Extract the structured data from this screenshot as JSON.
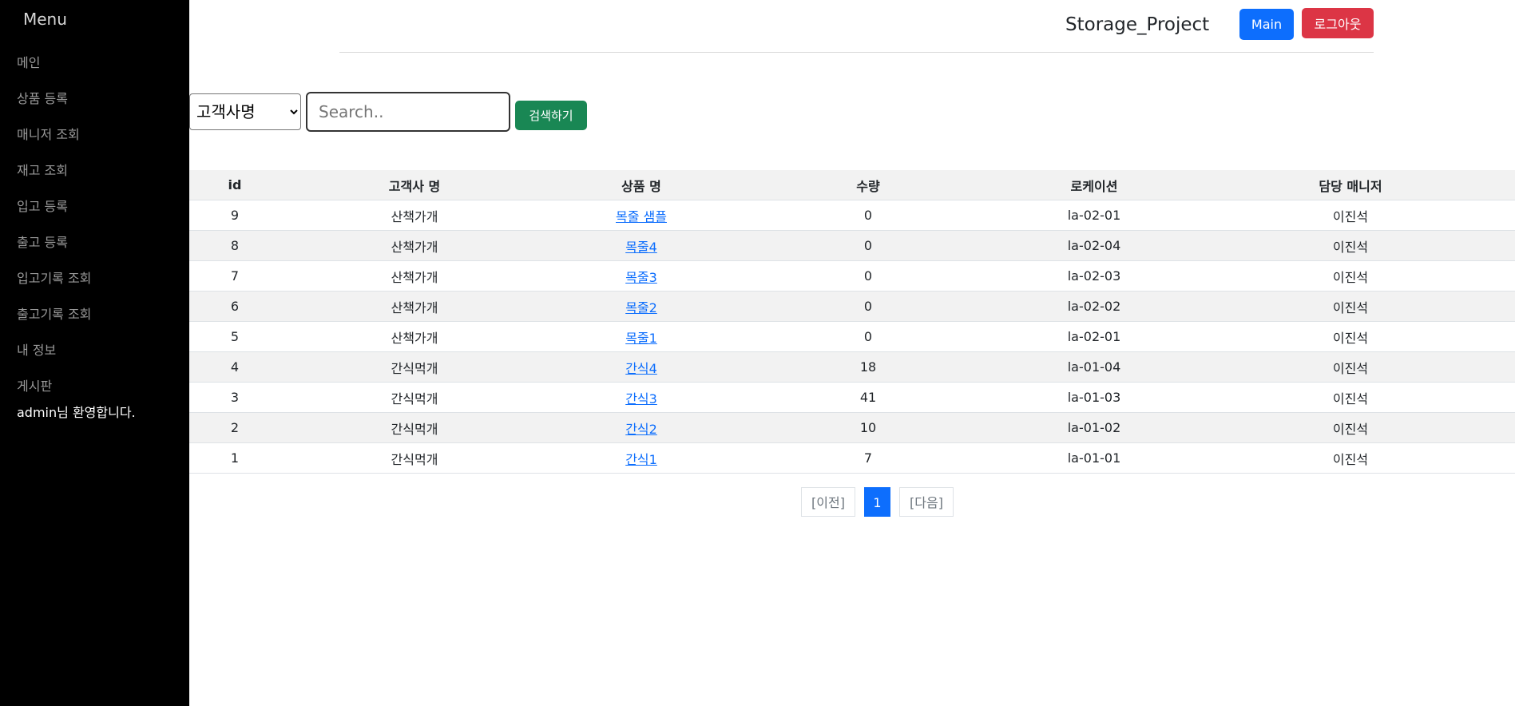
{
  "sidebar": {
    "title": "Menu",
    "items": [
      {
        "label": "메인"
      },
      {
        "label": "상품 등록"
      },
      {
        "label": "매니저 조회"
      },
      {
        "label": "재고 조회"
      },
      {
        "label": "입고 등록"
      },
      {
        "label": "출고 등록"
      },
      {
        "label": "입고기록 조회"
      },
      {
        "label": "출고기록 조회"
      },
      {
        "label": "내 정보"
      },
      {
        "label": "게시판"
      }
    ],
    "welcome": "admin님 환영합니다."
  },
  "header": {
    "title": "Storage_Project",
    "main_label": "Main",
    "logout_label": "로그아웃"
  },
  "search": {
    "select_options": [
      "고객사명"
    ],
    "selected": "고객사명",
    "placeholder": "Search..",
    "value": "",
    "button_label": "검색하기"
  },
  "table": {
    "headers": [
      "id",
      "고객사 명",
      "상품 명",
      "수량",
      "로케이션",
      "담당 매니저"
    ],
    "rows": [
      {
        "id": "9",
        "customer": "산책가개",
        "product": "목줄 샘플",
        "qty": "0",
        "location": "la-02-01",
        "manager": "이진석"
      },
      {
        "id": "8",
        "customer": "산책가개",
        "product": "목줄4",
        "qty": "0",
        "location": "la-02-04",
        "manager": "이진석"
      },
      {
        "id": "7",
        "customer": "산책가개",
        "product": "목줄3",
        "qty": "0",
        "location": "la-02-03",
        "manager": "이진석"
      },
      {
        "id": "6",
        "customer": "산책가개",
        "product": "목줄2",
        "qty": "0",
        "location": "la-02-02",
        "manager": "이진석"
      },
      {
        "id": "5",
        "customer": "산책가개",
        "product": "목줄1",
        "qty": "0",
        "location": "la-02-01",
        "manager": "이진석"
      },
      {
        "id": "4",
        "customer": "간식먹개",
        "product": "간식4",
        "qty": "18",
        "location": "la-01-04",
        "manager": "이진석"
      },
      {
        "id": "3",
        "customer": "간식먹개",
        "product": "간식3",
        "qty": "41",
        "location": "la-01-03",
        "manager": "이진석"
      },
      {
        "id": "2",
        "customer": "간식먹개",
        "product": "간식2",
        "qty": "10",
        "location": "la-01-02",
        "manager": "이진석"
      },
      {
        "id": "1",
        "customer": "간식먹개",
        "product": "간식1",
        "qty": "7",
        "location": "la-01-01",
        "manager": "이진석"
      }
    ]
  },
  "pagination": {
    "prev_label": "[이전]",
    "current_page": "1",
    "next_label": "[다음]"
  },
  "colors": {
    "sidebar_bg": "#000000",
    "primary": "#0d6efd",
    "danger": "#dc3545",
    "success": "#198754",
    "stripe": "#f2f2f2"
  }
}
